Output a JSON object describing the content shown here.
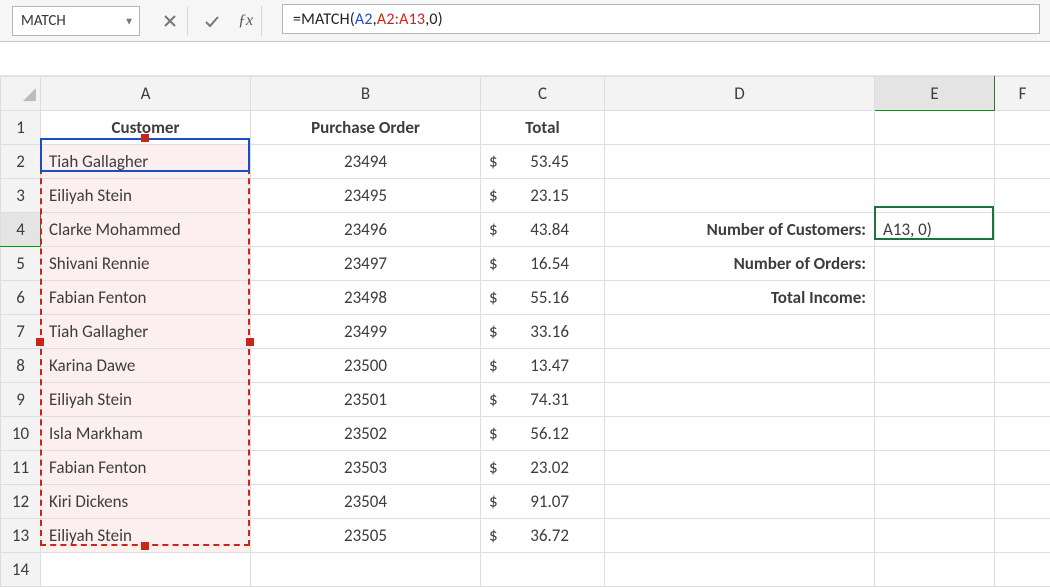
{
  "topbar": {
    "namebox_value": "MATCH",
    "formula_prefix": "=MATCH(",
    "formula_ref1": "A2",
    "formula_sep1": ", ",
    "formula_ref2": "A2:A13",
    "formula_sep2": ", ",
    "formula_arg3": "0",
    "formula_suffix": ")"
  },
  "columns": [
    "A",
    "B",
    "C",
    "D",
    "E",
    "F"
  ],
  "row_numbers": [
    "1",
    "2",
    "3",
    "4",
    "5",
    "6",
    "7",
    "8",
    "9",
    "10",
    "11",
    "12",
    "13",
    "14"
  ],
  "headers": {
    "A": "Customer",
    "B": "Purchase Order",
    "C": "Total"
  },
  "rows": [
    {
      "customer": "Tiah Gallagher",
      "po": "23494",
      "total": "53.45"
    },
    {
      "customer": "Eiliyah Stein",
      "po": "23495",
      "total": "23.15"
    },
    {
      "customer": "Clarke Mohammed",
      "po": "23496",
      "total": "43.84"
    },
    {
      "customer": "Shivani Rennie",
      "po": "23497",
      "total": "16.54"
    },
    {
      "customer": "Fabian Fenton",
      "po": "23498",
      "total": "55.16"
    },
    {
      "customer": "Tiah Gallagher",
      "po": "23499",
      "total": "33.16"
    },
    {
      "customer": "Karina Dawe",
      "po": "23500",
      "total": "13.47"
    },
    {
      "customer": "Eiliyah Stein",
      "po": "23501",
      "total": "74.31"
    },
    {
      "customer": "Isla Markham",
      "po": "23502",
      "total": "56.12"
    },
    {
      "customer": "Fabian Fenton",
      "po": "23503",
      "total": "23.02"
    },
    {
      "customer": "Kiri Dickens",
      "po": "23504",
      "total": "91.07"
    },
    {
      "customer": "Eiliyah Stein",
      "po": "23505",
      "total": "36.72"
    }
  ],
  "currency_symbol": "$",
  "side_labels": {
    "num_customers": "Number of Customers:",
    "num_orders": "Number of Orders:",
    "total_income": "Total Income:"
  },
  "e4_display": "A13, 0)",
  "corner_glyph": "◢"
}
